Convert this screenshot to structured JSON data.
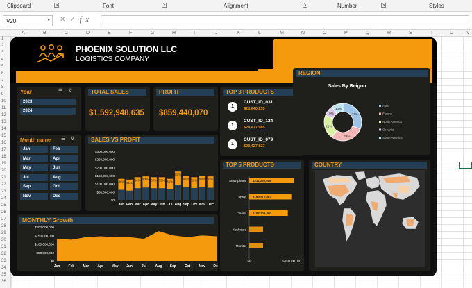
{
  "ribbon": {
    "groups": [
      {
        "label": "Clipboard",
        "x": 10
      },
      {
        "label": "Font",
        "x": 148
      },
      {
        "label": "Alignment",
        "x": 322
      },
      {
        "label": "Number",
        "x": 486
      },
      {
        "label": "Styles",
        "x": 618
      }
    ]
  },
  "formula_bar": {
    "name_box": "V20",
    "fx_label": "fx"
  },
  "columns": [
    "A",
    "B",
    "C",
    "D",
    "E",
    "F",
    "G",
    "H",
    "I",
    "J",
    "K",
    "L",
    "M",
    "N",
    "O",
    "P",
    "Q",
    "R",
    "S",
    "T",
    "U",
    "V"
  ],
  "rows": [
    "1",
    "2",
    "3",
    "4",
    "5",
    "6",
    "7",
    "8",
    "9",
    "10",
    "11",
    "12",
    "13",
    "14",
    "15",
    "16",
    "17",
    "18",
    "19",
    "20",
    "21",
    "22",
    "23",
    "24",
    "25",
    "26",
    "27",
    "28",
    "29",
    "30",
    "31",
    "32",
    "33",
    "34",
    "35",
    "36"
  ],
  "header": {
    "company": "PHOENIX SOLUTION LLC",
    "subtitle": "LOGISTICS COMPANY"
  },
  "year_slicer": {
    "title": "Year",
    "items": [
      "2023",
      "2024"
    ]
  },
  "month_slicer": {
    "title": "Month name",
    "items": [
      "Jan",
      "Feb",
      "Mar",
      "Apr",
      "May",
      "Jun",
      "Jul",
      "Aug",
      "Sep",
      "Oct",
      "Nov",
      "Dec"
    ]
  },
  "kpi": {
    "total_sales_title": "TOTAL SALES",
    "total_sales": "$1,592,948,635",
    "profit_title": "PROFIT",
    "profit": "$859,440,070"
  },
  "top3": {
    "title": "TOP 3 PRODUCTS",
    "items": [
      {
        "rank": "1",
        "name": "CUST_ID_031",
        "value": "$28,640,255"
      },
      {
        "rank": "1",
        "name": "CUST_ID_124",
        "value": "$24,477,985"
      },
      {
        "rank": "1",
        "name": "CUST_ID_079",
        "value": "$23,427,827"
      }
    ]
  },
  "region": {
    "title": "REGION"
  },
  "top5": {
    "title": "TOP 5 PRODUCTS"
  },
  "country": {
    "title": "COUNTRY"
  },
  "sales_vs_profit": {
    "title": "SALES VS PROFIT"
  },
  "monthly": {
    "title": "MONTHLY Growth"
  },
  "chart_data": [
    {
      "type": "bar",
      "title": "SALES VS PROFIT",
      "categories": [
        "Jan",
        "Feb",
        "Mar",
        "Apr",
        "May",
        "Jun",
        "Jul",
        "Aug",
        "Sep",
        "Oct",
        "Nov",
        "Dec"
      ],
      "y_ticks": [
        "$0",
        "$50,000,000",
        "$100,000,000",
        "$150,000,000",
        "$200,000,000",
        "$250,000,000",
        "$300,000,000"
      ],
      "ylim": [
        0,
        300000000
      ],
      "series": [
        {
          "values": [
            130000000,
            125000000,
            140000000,
            145000000,
            140000000,
            140000000,
            130000000,
            175000000,
            150000000,
            140000000,
            150000000,
            145000000
          ],
          "color": "#f49a0c"
        },
        {
          "values": [
            62000000,
            57000000,
            72000000,
            76000000,
            72000000,
            72000000,
            65000000,
            94000000,
            78000000,
            73000000,
            78000000,
            75000000
          ],
          "color": "#243f55"
        }
      ],
      "data_labels": [
        "49%",
        "51%",
        "54%",
        "53%",
        "53%",
        "53%",
        "51%",
        "57%",
        "53%",
        "53%",
        "54%",
        "54%"
      ]
    },
    {
      "type": "area",
      "title": "MONTHLY Growth",
      "categories": [
        "Jan",
        "Feb",
        "Mar",
        "Apr",
        "May",
        "Jun",
        "Jul",
        "Aug",
        "Sep",
        "Oct",
        "Nov",
        "Dec"
      ],
      "y_ticks": [
        "$0",
        "$50,000,000",
        "$100,000,000",
        "$150,000,000",
        "$200,000,000"
      ],
      "ylim": [
        0,
        200000000
      ],
      "values": [
        130000000,
        125000000,
        140000000,
        145000000,
        140000000,
        140000000,
        130000000,
        175000000,
        150000000,
        140000000,
        150000000,
        145000000
      ],
      "color": "#f49a0c"
    },
    {
      "type": "pie",
      "title": "Sales By Reigon",
      "slices": [
        {
          "label": "Asia",
          "value": 31,
          "text": "31%",
          "color": "#9dc3e6"
        },
        {
          "label": "Europe",
          "value": 29,
          "text": "29%",
          "color": "#f4b7b7"
        },
        {
          "label": "North America",
          "value": 21,
          "text": "21%",
          "color": "#d9f0a3"
        },
        {
          "label": "Oceania",
          "value": 9,
          "text": "9%",
          "color": "#d7c6e6"
        },
        {
          "label": "South America",
          "value": 10,
          "text": "10%",
          "color": "#bfe3f0"
        }
      ]
    },
    {
      "type": "bar",
      "title": "TOP 5 PRODUCTS",
      "categories": [
        "Smartphone",
        "Laptop",
        "Tablet",
        "Keyboard",
        "Monitor"
      ],
      "values": [
        211250986,
        199310067,
        183106460,
        0,
        0
      ],
      "data_labels": [
        "$211,250,986",
        "$199,310,067",
        "$183,106,460",
        "",
        ""
      ],
      "x_ticks": [
        "$0",
        "$200,000,000"
      ],
      "xlim": [
        0,
        230000000
      ],
      "color": "#f49a0c"
    }
  ]
}
